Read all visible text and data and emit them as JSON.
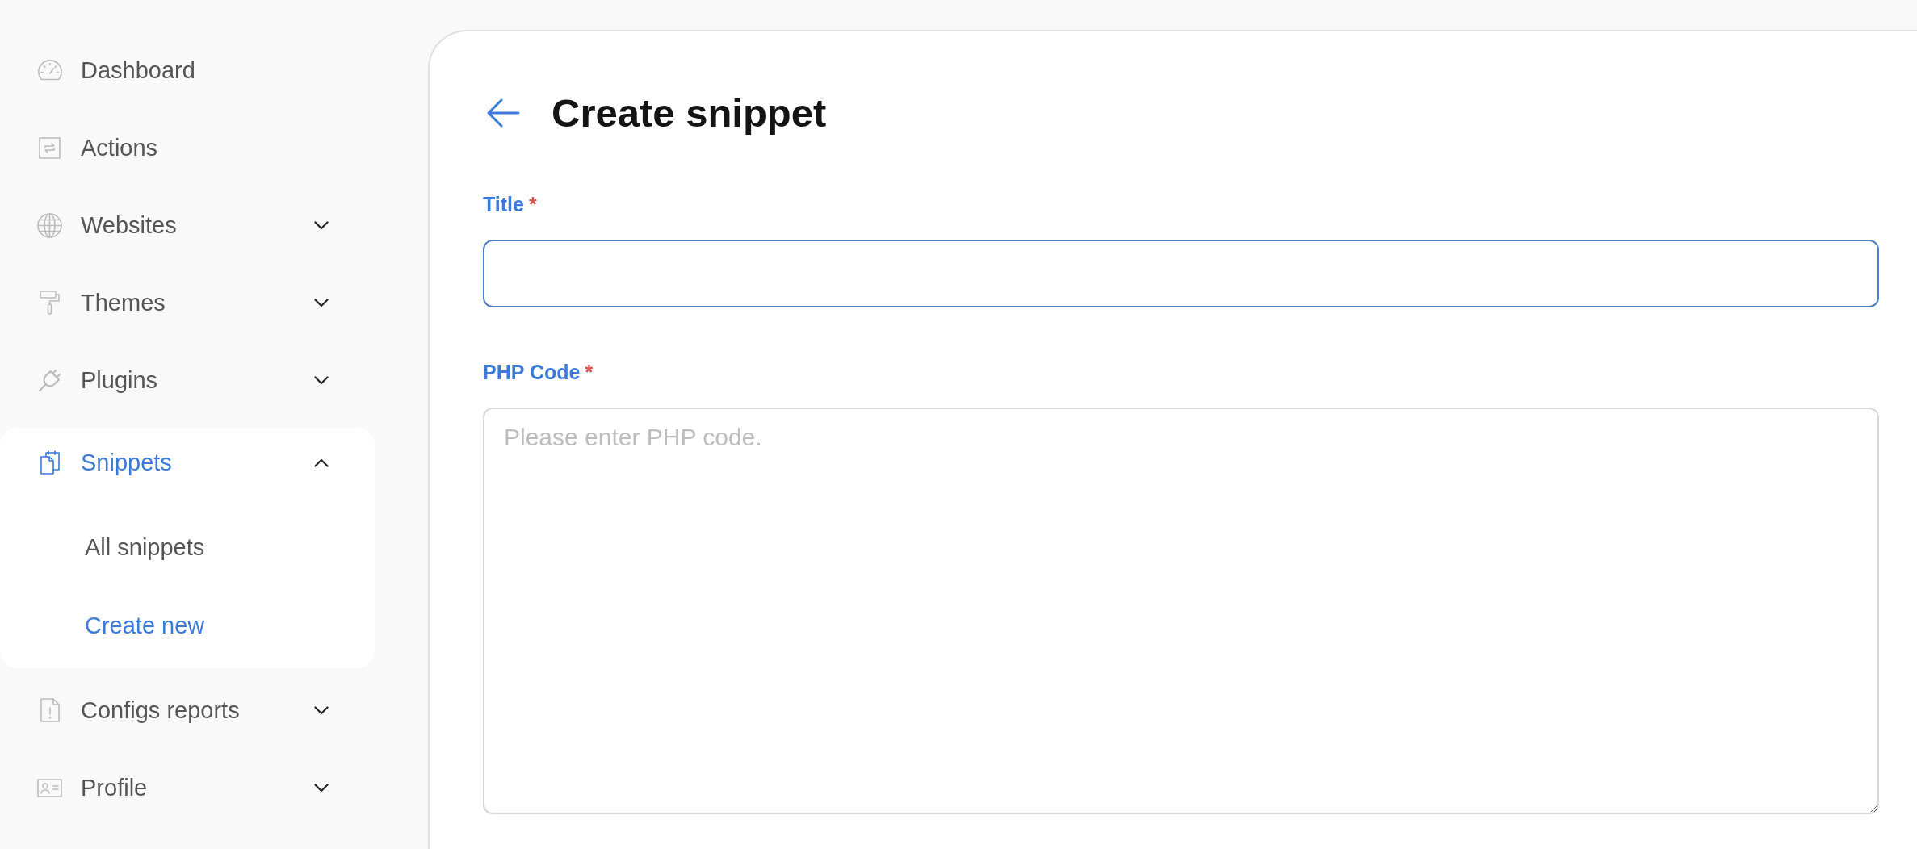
{
  "sidebar": {
    "items": [
      {
        "kind": "link",
        "label": "Dashboard",
        "selected": false
      },
      {
        "kind": "link",
        "label": "Actions",
        "selected": false
      },
      {
        "kind": "group",
        "label": "Websites",
        "selected": false,
        "expanded": false
      },
      {
        "kind": "group",
        "label": "Themes",
        "selected": false,
        "expanded": false
      },
      {
        "kind": "group",
        "label": "Plugins",
        "selected": false,
        "expanded": false
      },
      {
        "kind": "group",
        "label": "Snippets",
        "selected": true,
        "expanded": true,
        "children": [
          {
            "label": "All snippets",
            "selected": false
          },
          {
            "label": "Create new",
            "selected": true
          }
        ]
      },
      {
        "kind": "group",
        "label": "Configs reports",
        "selected": false,
        "expanded": false
      },
      {
        "kind": "group",
        "label": "Profile",
        "selected": false,
        "expanded": false
      }
    ]
  },
  "header": {
    "title": "Create snippet"
  },
  "form": {
    "fields": [
      {
        "kind": "input",
        "label": "Title",
        "required_mark": "*",
        "focused": true
      },
      {
        "kind": "textarea",
        "label": "PHP Code",
        "required_mark": "*",
        "placeholder": "Please enter PHP code.",
        "focused": false
      }
    ]
  }
}
